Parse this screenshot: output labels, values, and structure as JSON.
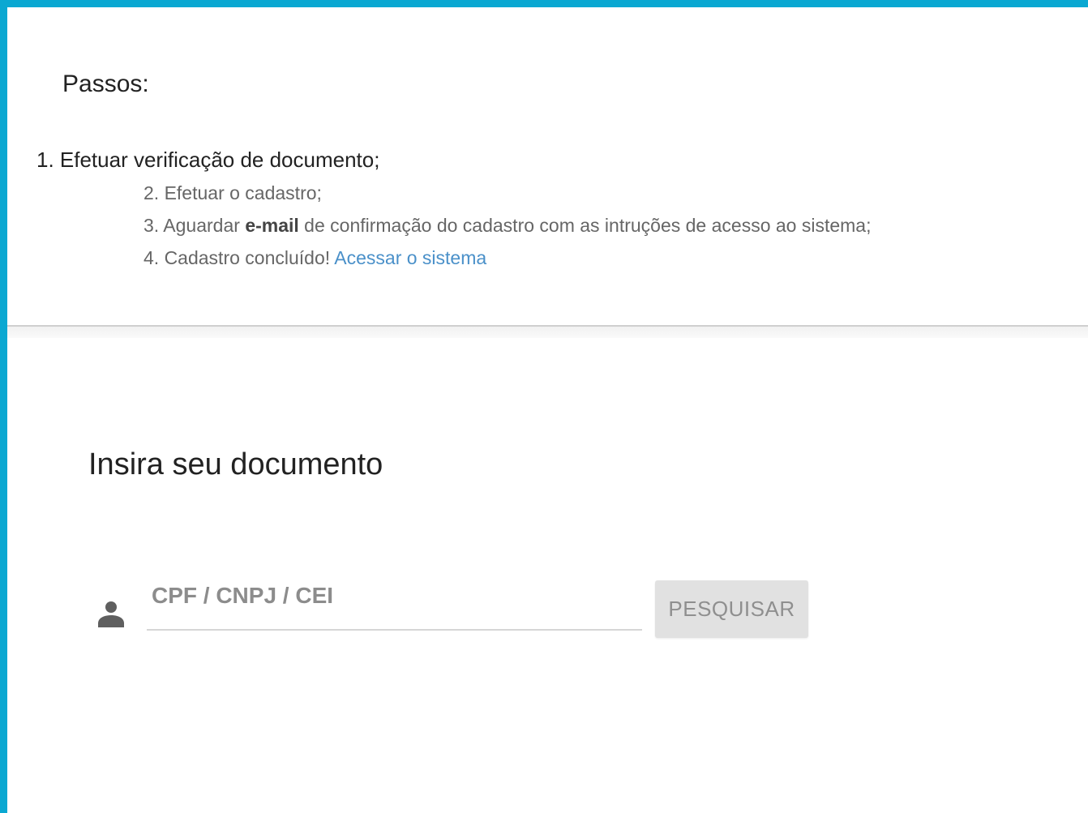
{
  "steps": {
    "title": "Passos:",
    "step1": "1. Efetuar verificação de documento;",
    "step2": "2. Efetuar o cadastro;",
    "step3_prefix": "3. Aguardar ",
    "step3_bold": "e-mail",
    "step3_suffix": " de confirmação do cadastro com as intruções de acesso ao sistema;",
    "step4_prefix": "4. Cadastro concluído! ",
    "step4_link": "Acessar o sistema"
  },
  "form": {
    "title": "Insira seu documento",
    "input_placeholder": "CPF / CNPJ / CEI",
    "input_value": "",
    "search_label": "PESQUISAR",
    "user_icon": "person-icon"
  },
  "colors": {
    "accent_border": "#0aa8d2",
    "link": "#4a90c9",
    "button_disabled_bg": "#e1e1e1",
    "button_disabled_text": "#8f8f8f"
  }
}
